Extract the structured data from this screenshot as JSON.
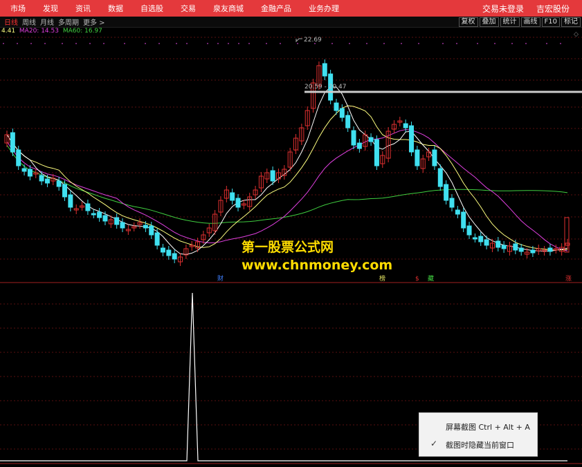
{
  "nav": {
    "items": [
      "市场",
      "发现",
      "资讯",
      "数据",
      "自选股",
      "交易",
      "泉友商城",
      "金融产品",
      "业务办理"
    ],
    "login_status": "交易未登录",
    "broker": "吉宏股份"
  },
  "periods": [
    "日线",
    "周线",
    "月线",
    "多周期",
    "更多 >"
  ],
  "toolbar": [
    "复权",
    "叠加",
    "统计",
    "画线",
    "F10",
    "标记"
  ],
  "ma": {
    "ma_first": "4.41",
    "ma20": "MA20: 14.53",
    "ma60": "MA60: 16.97",
    "ma20_color": "#e040e0",
    "ma60_color": "#40d040"
  },
  "price_labels": {
    "high": "22.69",
    "range": "20.59 - 20.47"
  },
  "markers": {
    "cai": "财",
    "bang": "榜",
    "dollar": "$",
    "cang": "藏",
    "zhang": "涨"
  },
  "watermark": {
    "line1": "第一股票公式网",
    "line2": "www.chnmoney.com"
  },
  "popup": {
    "screenshot": "屏幕截图 Ctrl + Alt + A",
    "hide_window": "截图时隐藏当前窗口",
    "check": "✓"
  },
  "colors": {
    "nav_bg": "#e4393c",
    "up": "#e03030",
    "down": "#40e0f0",
    "ma5": "#ffffff",
    "ma10": "#ffff80",
    "ma20": "#e040e0",
    "ma60": "#40d040"
  },
  "chart_data": {
    "type": "candlestick",
    "price_high": 22.69,
    "range_low": 20.47,
    "range_high": 20.59,
    "indicator": {
      "type": "line",
      "spike_index": 58
    }
  }
}
